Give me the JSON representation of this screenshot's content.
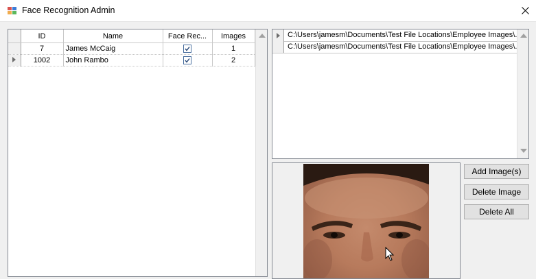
{
  "window": {
    "title": "Face Recognition Admin"
  },
  "employees_grid": {
    "columns": [
      "ID",
      "Name",
      "Face Rec...",
      "Images"
    ],
    "rows": [
      {
        "id": "7",
        "name": "James McCaig",
        "face_rec": true,
        "images": "1"
      },
      {
        "id": "1002",
        "name": "John Rambo",
        "face_rec": true,
        "images": "2"
      }
    ]
  },
  "images_grid": {
    "rows": [
      {
        "path": "C:\\Users\\jamesm\\Documents\\Test File Locations\\Employee Images\\..."
      },
      {
        "path": "C:\\Users\\jamesm\\Documents\\Test File Locations\\Employee Images\\..."
      }
    ]
  },
  "buttons": {
    "add_images": "Add Image(s)",
    "delete_image": "Delete Image",
    "delete_all": "Delete All"
  },
  "colors": {
    "window_bg": "#f0f0f0",
    "button_bg": "#e1e1e1",
    "grid_border": "#828790",
    "checkbox_border": "#4a6f9f"
  },
  "icons": [
    "app-icon",
    "close-icon",
    "scroll-up-icon",
    "scroll-down-icon",
    "row-arrow-icon",
    "checkbox-icon",
    "mouse-cursor-icon"
  ]
}
